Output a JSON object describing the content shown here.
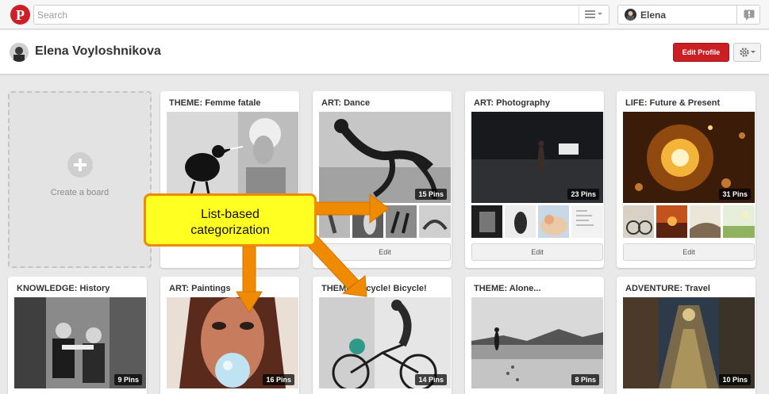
{
  "topbar": {
    "logo_icon": "pinterest-logo-icon",
    "search_placeholder": "Search",
    "user_name": "Elena",
    "accent": "#cb2027"
  },
  "profile": {
    "name": "Elena Voyloshnikova",
    "edit_button": "Edit Profile",
    "settings_icon": "gear-icon"
  },
  "create_board": {
    "label": "Create a board"
  },
  "boards": [
    {
      "title": "THEME: Femme fatale",
      "pins": "",
      "edit": "Edit"
    },
    {
      "title": "ART: Dance",
      "pins": "15 Pins",
      "edit": "Edit"
    },
    {
      "title": "ART: Photography",
      "pins": "23 Pins",
      "edit": "Edit"
    },
    {
      "title": "LIFE: Future & Present",
      "pins": "31 Pins",
      "edit": "Edit"
    },
    {
      "title": "KNOWLEDGE: History",
      "pins": "9 Pins"
    },
    {
      "title": "ART: Paintings",
      "pins": "16 Pins"
    },
    {
      "title": "THEME: Bicycle! Bicycle!",
      "pins": "14 Pins"
    },
    {
      "title": "THEME: Alone...",
      "pins": "8 Pins"
    },
    {
      "title": "ADVENTURE: Travel",
      "pins": "10 Pins"
    }
  ],
  "annotation": {
    "line1": "List-based",
    "line2": "categorization",
    "color": "#f08a00"
  }
}
